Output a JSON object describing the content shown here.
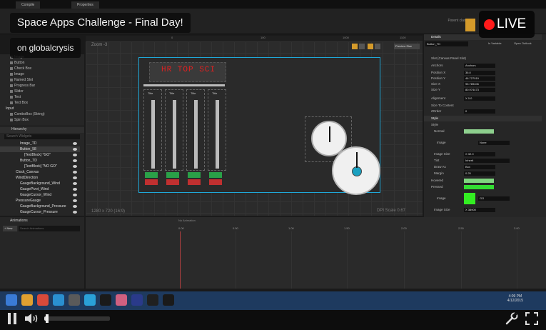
{
  "editor": {
    "tabs": [
      "Compile",
      "Properties"
    ],
    "parent_class": "Parent class",
    "zoom_label": "Zoom -3",
    "ruler": [
      "0",
      "100",
      "1000",
      "1100"
    ],
    "resolution": "1280 x 720 (16:9)",
    "dpi_scale": "DPI Scale 0.67",
    "preview_size": "Preview Size",
    "widget_title": "HR TOP SCI",
    "gauge_title": "Title"
  },
  "palette": {
    "items": [
      "Image",
      "Button",
      "Check Box",
      "Image",
      "Named Slot",
      "Progress Bar",
      "Slider",
      "Text",
      "Text Box"
    ],
    "category_input": "Input",
    "input_items": [
      "ComboBox (String)",
      "Spin Box"
    ]
  },
  "hierarchy": {
    "header": "Hierarchy",
    "search_placeholder": "Search Widgets",
    "items": [
      "Image_TD",
      "Button_58",
      "[TextBlock] \"GO\"",
      "Button_TD",
      "[TextBlock] \"NO GO\"",
      "Clock_Canvas",
      "WindDirection",
      "GaugeBackground_Wind",
      "GaugePivot_Wind",
      "GaugeCursor_Wind",
      "PressureGauge",
      "GaugeBackground_Pressure",
      "GaugeCursor_Pressure"
    ]
  },
  "details": {
    "header": "Details",
    "widget_name": "Button_TD",
    "is_variable": "Is Variable",
    "open_outlook": "Open Outlook",
    "slot_section": "Slot (Canvas Panel Slot)",
    "rows": [
      {
        "label": "Anchors",
        "value": "Anchors"
      },
      {
        "label": "Position X",
        "value": "36.0"
      },
      {
        "label": "Position Y",
        "value": "46.727019"
      },
      {
        "label": "Size X",
        "value": "95.789406"
      },
      {
        "label": "Size Y",
        "value": "80.974473"
      },
      {
        "label": "Alignment",
        "value": "X 0.0"
      },
      {
        "label": "Size To Content",
        "value": ""
      },
      {
        "label": "ZOrder",
        "value": "0"
      }
    ],
    "style_section": "Style",
    "style_rows": [
      {
        "label": "Style",
        "value": ""
      },
      {
        "label": "Normal",
        "value": ""
      },
      {
        "label": "Image",
        "value": "None"
      },
      {
        "label": "Image Size",
        "value": "X 32.0"
      },
      {
        "label": "Tint",
        "value": "Inherit"
      },
      {
        "label": "Draw As",
        "value": "Box"
      },
      {
        "label": "Margin",
        "value": "0.25"
      },
      {
        "label": "Hovered",
        "value": ""
      },
      {
        "label": "Pressed",
        "value": ""
      },
      {
        "label": "Image",
        "value": "GO"
      },
      {
        "label": "Image Size",
        "value": "X 38900"
      }
    ]
  },
  "animations": {
    "header": "Animations",
    "new_button": "+ New",
    "search_placeholder": "Search Animations",
    "no_animation": "No Animation",
    "ticks": [
      "0.00",
      "0.50",
      "1.00",
      "1.50",
      "2.00",
      "2.50",
      "3.00"
    ]
  },
  "taskbar": {
    "time": "4:09 PM",
    "date": "4/12/2015",
    "icon_colors": [
      "#3a7bd5",
      "#e0a030",
      "#d84a3a",
      "#2a8fd0",
      "#5a5a5a",
      "#2aa0d8",
      "#1a1a1a",
      "#d06080",
      "#2a3a8a",
      "#202020",
      "#1a1a1a"
    ]
  },
  "stream": {
    "title": "Space Apps Challenge - Final Day!",
    "subtitle": "on globalcrysis",
    "live": "LIVE",
    "live_color": "#ff1a1a",
    "progress": 0.04
  }
}
